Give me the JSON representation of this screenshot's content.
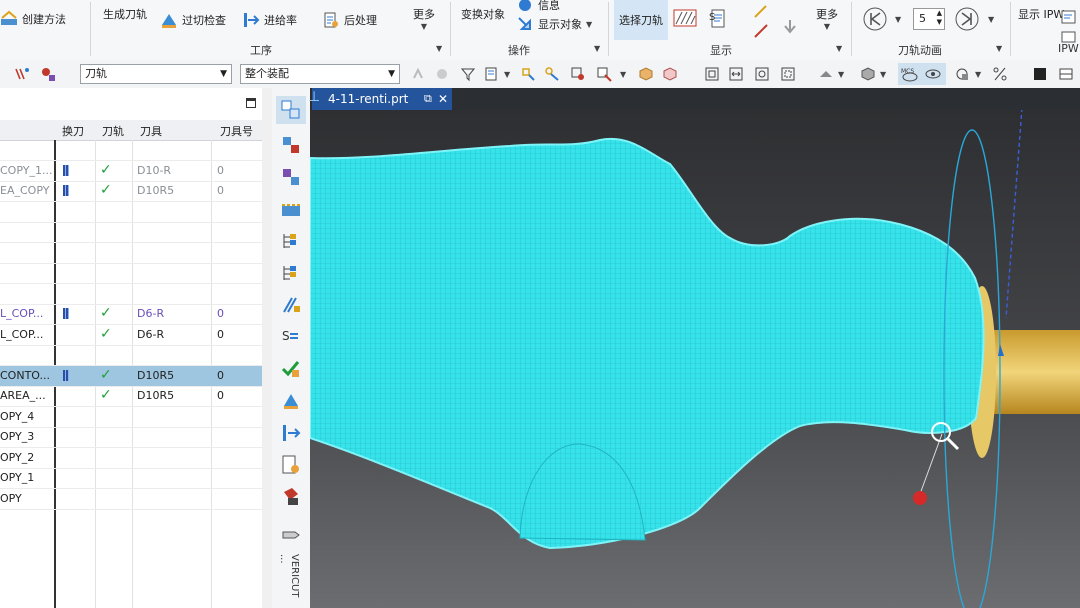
{
  "ribbon": {
    "create_method": "创建方法",
    "generate_toolpath": "生成刀轨",
    "gouge_check": "过切检查",
    "feed_rate": "进给率",
    "postprocess": "后处理",
    "more": "更多",
    "transform_object": "变换对象",
    "info": "信息",
    "display_object": "显示对象",
    "select_toolpath": "选择刀轨",
    "display_more": "更多",
    "display_ipw": "显示 IPW",
    "anim_speed": "5",
    "groups": {
      "process": "工序",
      "operation": "操作",
      "display": "显示",
      "toolpath_animation": "刀轨动画",
      "ipw": "IPW"
    }
  },
  "toolbar": {
    "filter_combo": "刀轨",
    "scope_combo": "整个装配"
  },
  "navigator": {
    "columns": [
      "换刀",
      "刀轨",
      "刀具",
      "刀具号"
    ],
    "rows": [
      {
        "name": "",
        "tool": "",
        "num": "",
        "change": false,
        "check": false,
        "style": "plain",
        "selected": false
      },
      {
        "name": "COPY_1...",
        "tool": "D10-R",
        "num": "0",
        "change": true,
        "check": true,
        "style": "gray",
        "selected": false
      },
      {
        "name": "EA_COPY",
        "tool": "D10R5",
        "num": "0",
        "change": true,
        "check": true,
        "style": "gray",
        "selected": false
      },
      {
        "name": "",
        "tool": "",
        "num": "",
        "change": false,
        "check": false,
        "style": "plain",
        "selected": false
      },
      {
        "name": "",
        "tool": "",
        "num": "",
        "change": false,
        "check": false,
        "style": "plain",
        "selected": false
      },
      {
        "name": "",
        "tool": "",
        "num": "",
        "change": false,
        "check": false,
        "style": "plain",
        "selected": false
      },
      {
        "name": "",
        "tool": "",
        "num": "",
        "change": false,
        "check": false,
        "style": "plain",
        "selected": false
      },
      {
        "name": "",
        "tool": "",
        "num": "",
        "change": false,
        "check": false,
        "style": "plain",
        "selected": false
      },
      {
        "name": "L_COP...",
        "tool": "D6-R",
        "num": "0",
        "change": true,
        "check": true,
        "style": "purple",
        "selected": false
      },
      {
        "name": "L_COP...",
        "tool": "D6-R",
        "num": "0",
        "change": false,
        "check": true,
        "style": "plain",
        "selected": false
      },
      {
        "name": "",
        "tool": "",
        "num": "",
        "change": false,
        "check": false,
        "style": "plain",
        "selected": false
      },
      {
        "name": "CONTO...",
        "tool": "D10R5",
        "num": "0",
        "change": true,
        "check": true,
        "style": "plain",
        "selected": true
      },
      {
        "name": "AREA_...",
        "tool": "D10R5",
        "num": "0",
        "change": false,
        "check": true,
        "style": "plain",
        "selected": false
      },
      {
        "name": "OPY_4",
        "tool": "",
        "num": "",
        "change": false,
        "check": false,
        "style": "plain",
        "selected": false
      },
      {
        "name": "OPY_3",
        "tool": "",
        "num": "",
        "change": false,
        "check": false,
        "style": "plain",
        "selected": false
      },
      {
        "name": "OPY_2",
        "tool": "",
        "num": "",
        "change": false,
        "check": false,
        "style": "plain",
        "selected": false
      },
      {
        "name": "OPY_1",
        "tool": "",
        "num": "",
        "change": false,
        "check": false,
        "style": "plain",
        "selected": false
      },
      {
        "name": "OPY",
        "tool": "",
        "num": "",
        "change": false,
        "check": false,
        "style": "plain",
        "selected": false
      }
    ]
  },
  "vertical_bar": {
    "vericut_label": "VERICUT ..."
  },
  "viewport": {
    "tab_title": "4-11-renti.prt"
  },
  "colors": {
    "toolpath_cyan": "#37e3ea",
    "part_gold": "#e0bf5a",
    "tab_blue": "#24559c",
    "selection_blue": "#9fc6e0",
    "check_green": "#1e9e3a",
    "purple_text": "#6a4fb8"
  }
}
